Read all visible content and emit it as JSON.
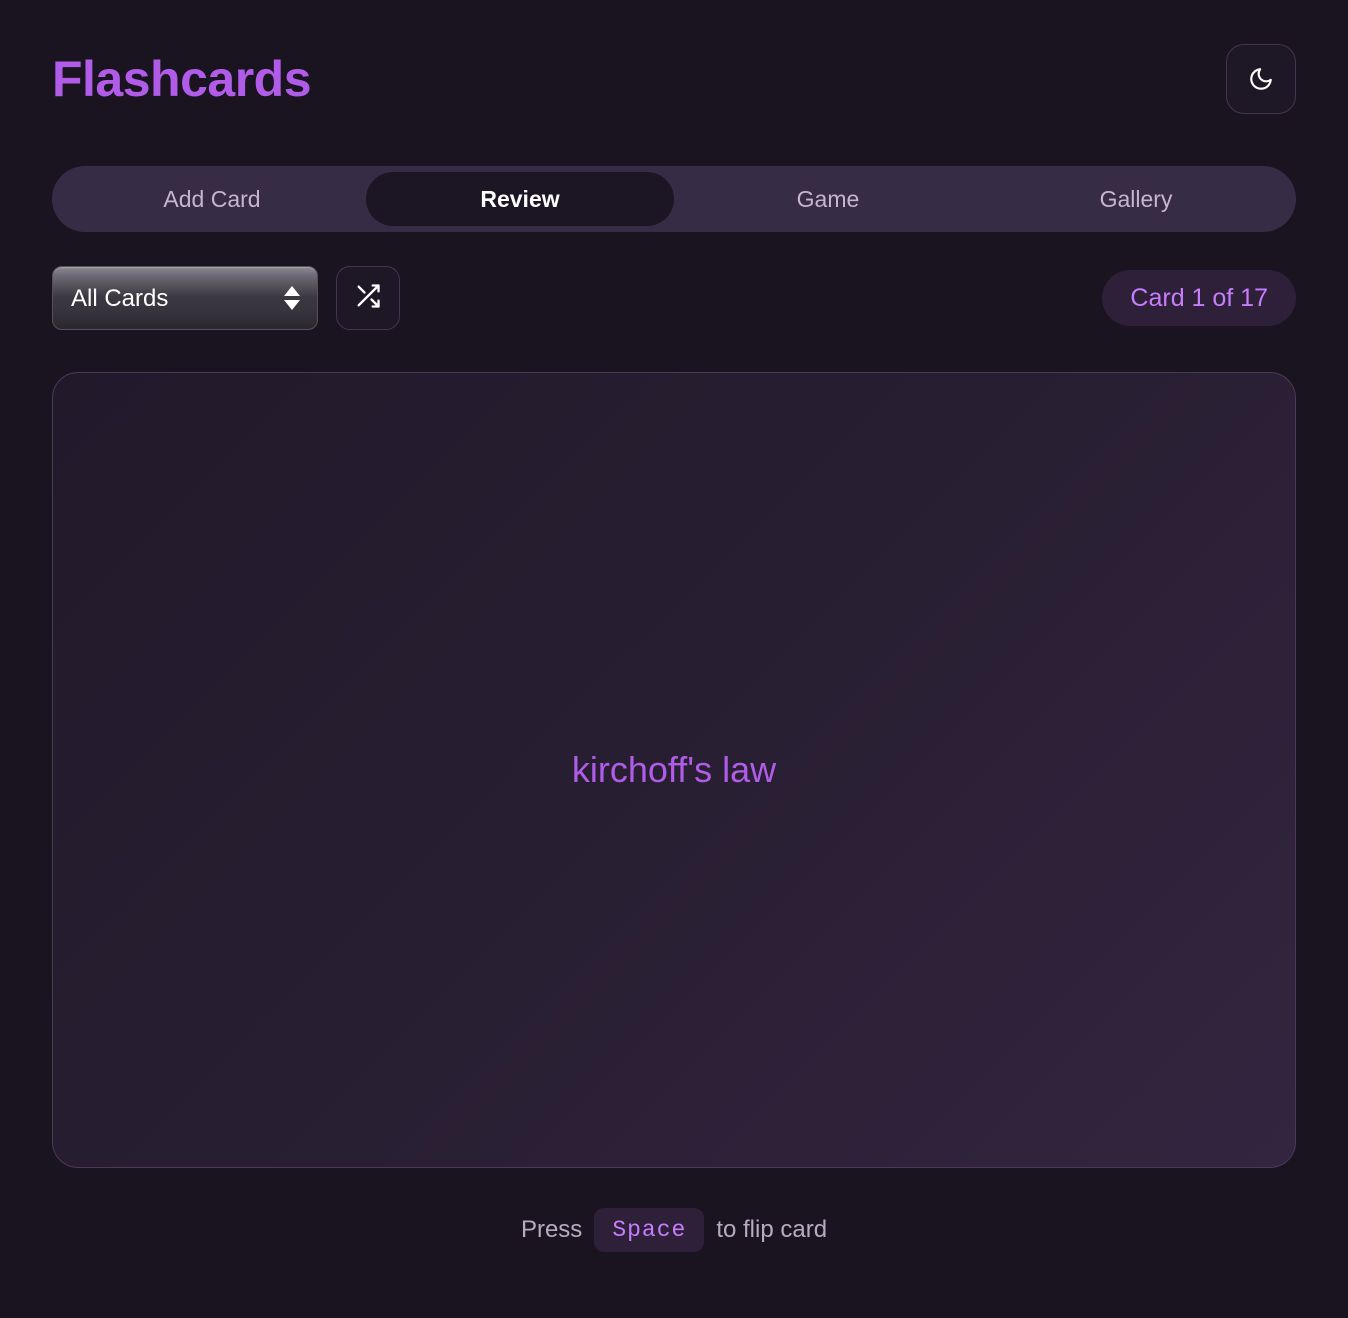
{
  "header": {
    "title": "Flashcards",
    "theme_toggle_icon": "moon-icon"
  },
  "tabs": [
    {
      "label": "Add Card",
      "active": false
    },
    {
      "label": "Review",
      "active": true
    },
    {
      "label": "Game",
      "active": false
    },
    {
      "label": "Gallery",
      "active": false
    }
  ],
  "controls": {
    "deck_select": {
      "value": "All Cards",
      "options": [
        "All Cards"
      ]
    },
    "shuffle_icon": "shuffle-icon",
    "counter": "Card 1 of 17"
  },
  "card": {
    "text": "kirchoff's law"
  },
  "hint": {
    "prefix": "Press",
    "key": "Space",
    "suffix": "to flip card"
  },
  "colors": {
    "page_bg": "#1a1420",
    "accent": "#b05ce8",
    "badge_text": "#c77dff",
    "badge_bg": "#2e2038",
    "tabbar_bg": "#362c45",
    "active_tab_bg": "#1c1524",
    "card_border": "#4a3a57"
  }
}
